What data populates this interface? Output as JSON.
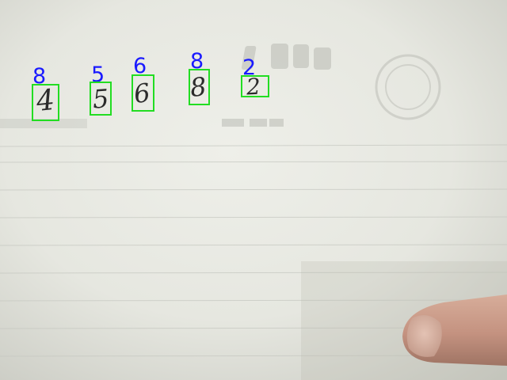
{
  "scene": {
    "description_colors": {
      "paper": "#e9eae3",
      "paper_dark": "#cfd0c9",
      "ruled_line": "#c6c8c1",
      "faint_print": "#b8b9b2",
      "finger": "#c89a86",
      "box": "#22dd22",
      "prediction": "#1a1aff"
    }
  },
  "detections": [
    {
      "predicted": "8",
      "handwritten": "4"
    },
    {
      "predicted": "5",
      "handwritten": "5"
    },
    {
      "predicted": "6",
      "handwritten": "6"
    },
    {
      "predicted": "8",
      "handwritten": "8"
    },
    {
      "predicted": "2",
      "handwritten": "2"
    }
  ]
}
